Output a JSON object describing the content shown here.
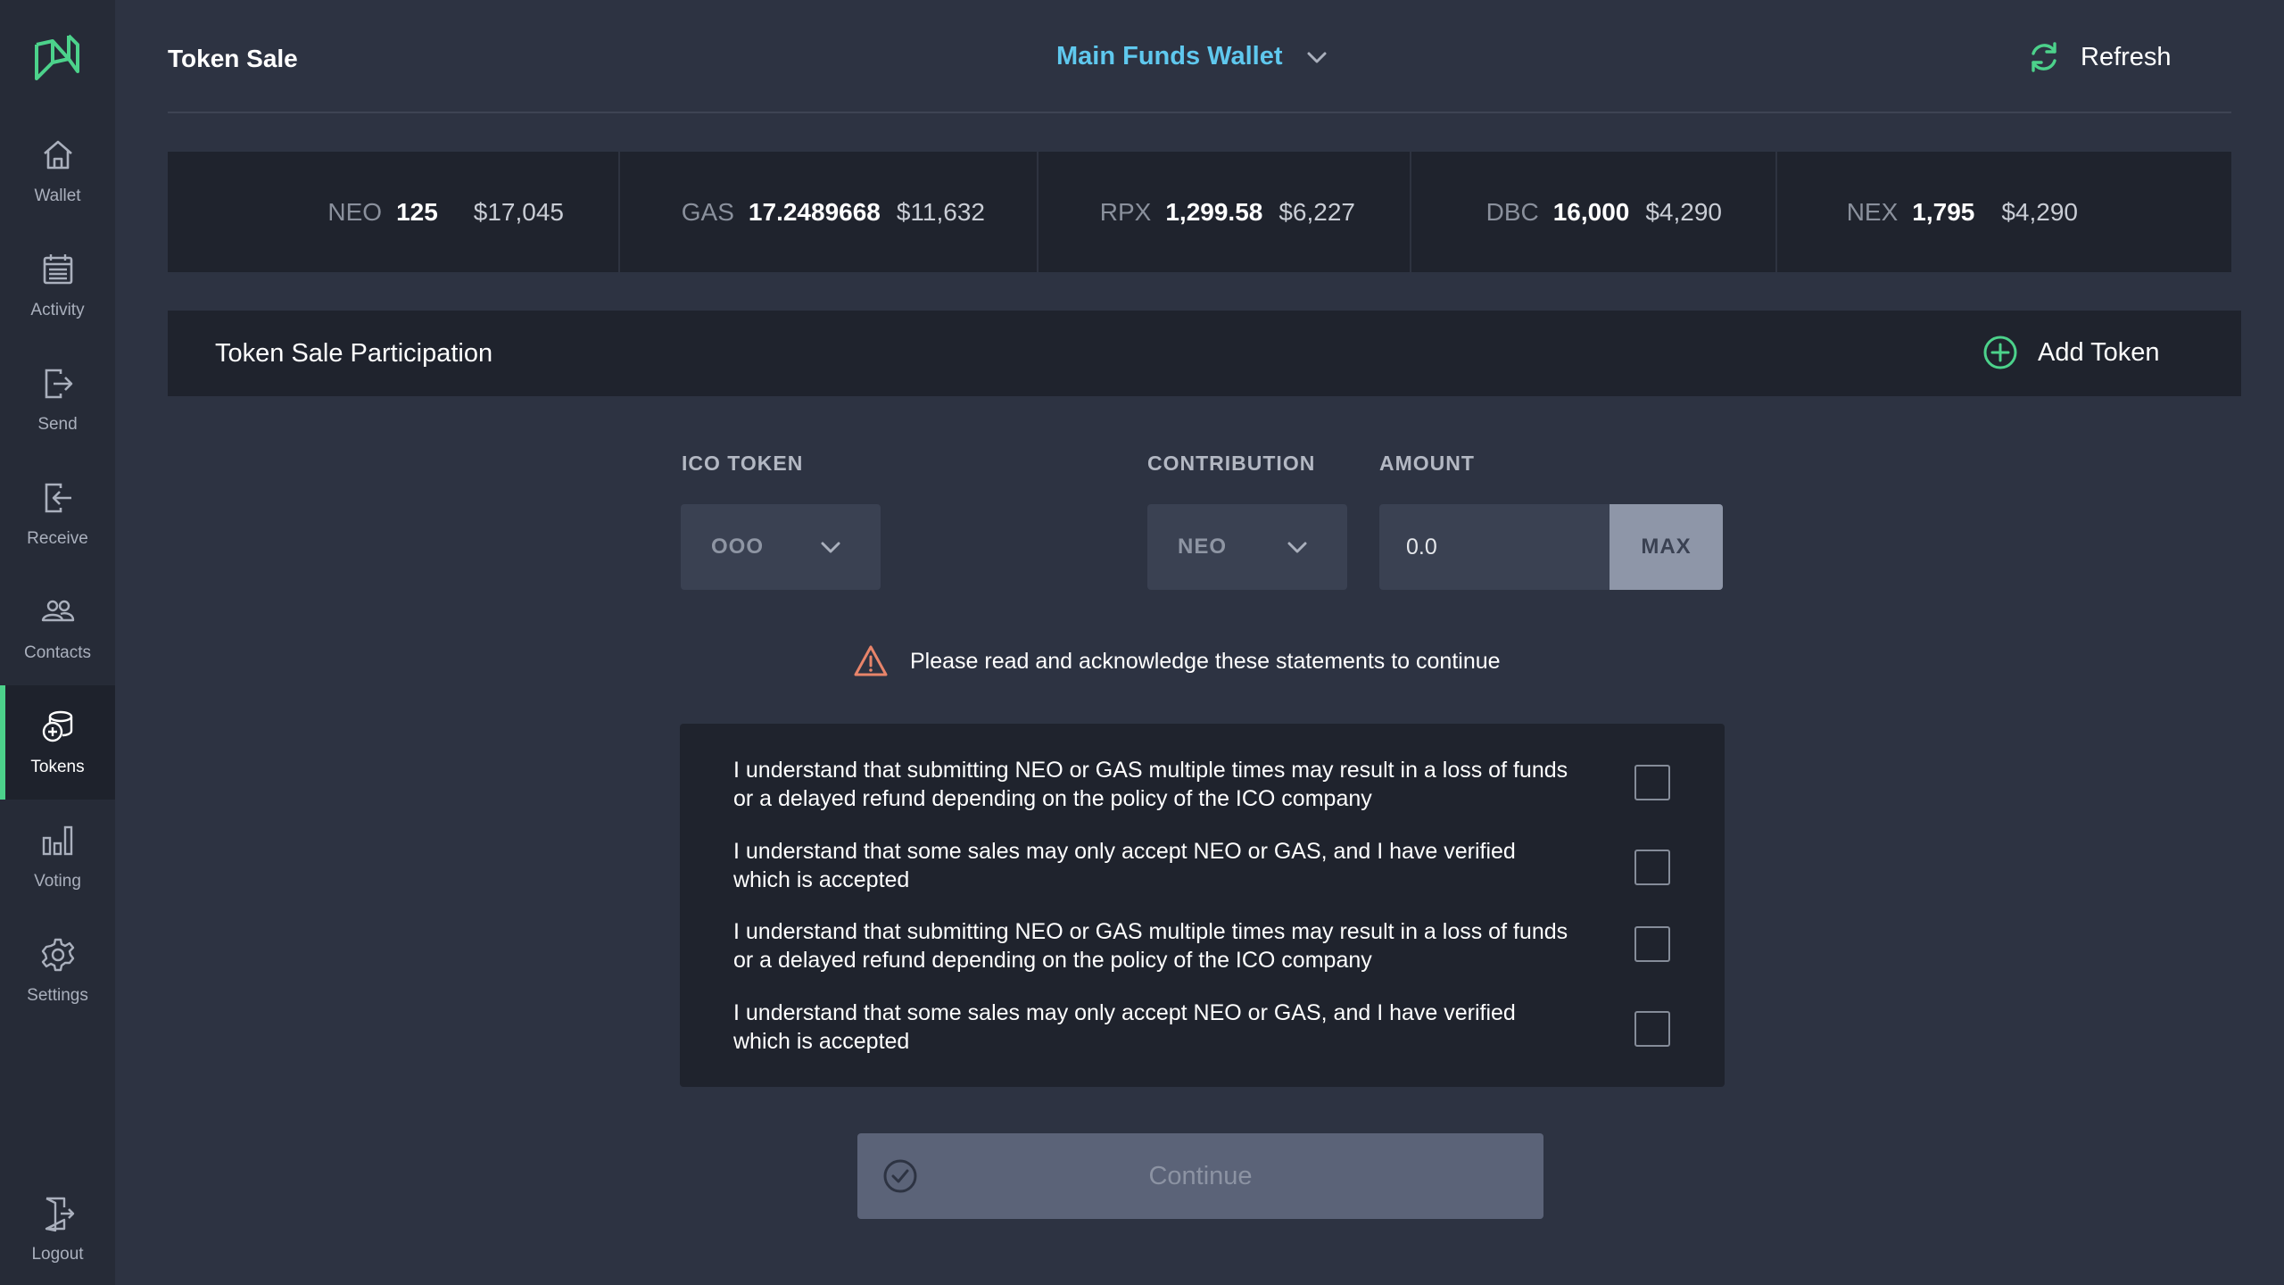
{
  "sidebar": {
    "items": [
      {
        "label": "Wallet",
        "icon": "home-icon"
      },
      {
        "label": "Activity",
        "icon": "calendar-icon"
      },
      {
        "label": "Send",
        "icon": "send-icon"
      },
      {
        "label": "Receive",
        "icon": "receive-icon"
      },
      {
        "label": "Contacts",
        "icon": "contacts-icon"
      },
      {
        "label": "Tokens",
        "icon": "tokens-icon",
        "active": true
      },
      {
        "label": "Voting",
        "icon": "bar-chart-icon"
      },
      {
        "label": "Settings",
        "icon": "gear-icon"
      }
    ],
    "logout_label": "Logout"
  },
  "header": {
    "title": "Token Sale",
    "wallet_name": "Main Funds Wallet",
    "refresh_label": "Refresh"
  },
  "balances": [
    {
      "symbol": "NEO",
      "amount": "125",
      "usd": "$17,045"
    },
    {
      "symbol": "GAS",
      "amount": "17.2489668",
      "usd": "$11,632"
    },
    {
      "symbol": "RPX",
      "amount": "1,299.58",
      "usd": "$6,227"
    },
    {
      "symbol": "DBC",
      "amount": "16,000",
      "usd": "$4,290"
    },
    {
      "symbol": "NEX",
      "amount": "1,795",
      "usd": "$4,290"
    }
  ],
  "panel": {
    "title": "Token Sale Participation",
    "add_token_label": "Add Token"
  },
  "form": {
    "ico_token_label": "ICO TOKEN",
    "ico_token_value": "OOO",
    "contribution_label": "CONTRIBUTION",
    "contribution_value": "NEO",
    "amount_label": "AMOUNT",
    "amount_value": "0.0",
    "max_label": "MAX"
  },
  "warning_text": "Please read and acknowledge these statements to continue",
  "statements": [
    "I understand that submitting NEO or GAS multiple times may result in a loss of funds or a delayed refund depending on the policy of the ICO company",
    "I understand that some sales may only accept NEO or GAS, and I have verified which is accepted",
    "I understand that submitting NEO or GAS multiple times may result in a loss of funds or a delayed refund depending on the policy of the ICO company",
    "I understand that some sales may only accept NEO or GAS, and I have verified which is accepted"
  ],
  "continue_label": "Continue",
  "colors": {
    "accent_green": "#4cd28b",
    "wallet_blue": "#5fc8ee",
    "warning_orange": "#e8846a"
  }
}
